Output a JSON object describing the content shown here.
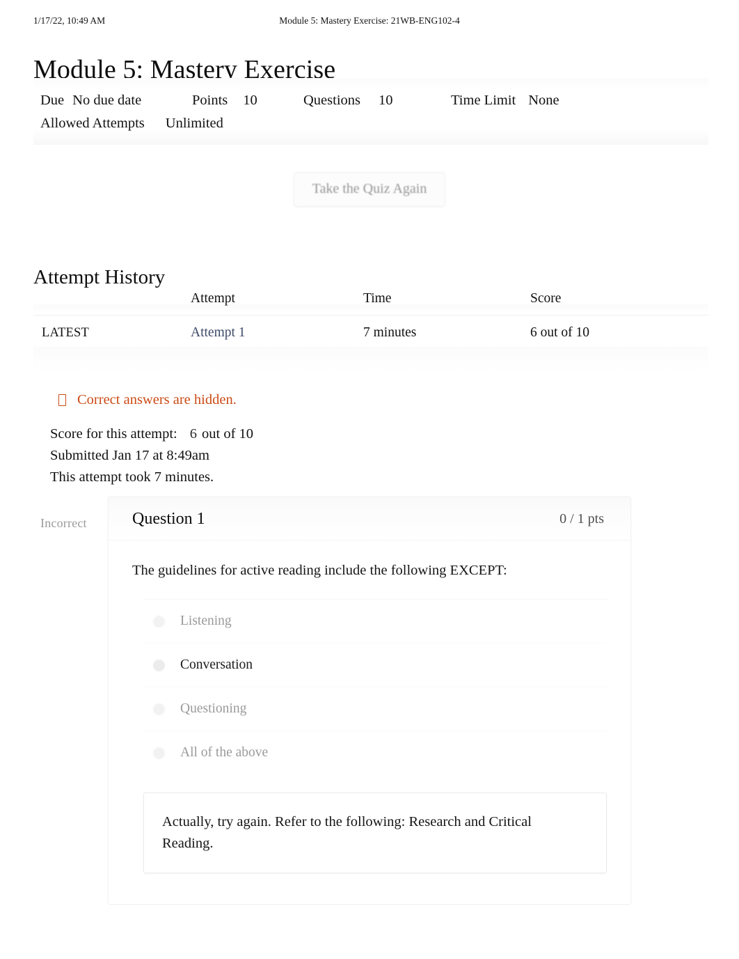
{
  "print_header": {
    "date": "1/17/22, 10:49 AM",
    "doc_title": "Module 5: Mastery Exercise: 21WB-ENG102-4"
  },
  "page_title": "Module 5: Mastery Exercise",
  "quiz_meta": {
    "due_label": "Due",
    "due_value": "No due date",
    "points_label": "Points",
    "points_value": "10",
    "questions_label": "Questions",
    "questions_value": "10",
    "time_limit_label": "Time Limit",
    "time_limit_value": "None",
    "allowed_attempts_label": "Allowed Attempts",
    "allowed_attempts_value": "Unlimited"
  },
  "retake_button": {
    "label": "Take the Quiz Again"
  },
  "attempt_history": {
    "heading": "Attempt History",
    "columns": [
      "",
      "Attempt",
      "Time",
      "Score"
    ],
    "rows": [
      {
        "kept": "LATEST",
        "attempt": "Attempt 1",
        "time": "7 minutes",
        "score": "6 out of 10"
      }
    ]
  },
  "hidden_notice": {
    "icon": "eye-slash-icon",
    "text": "Correct answers are hidden.",
    "color": "#cb4a14"
  },
  "attempt_summary": {
    "score_label": "Score for this attempt:",
    "score_value": "6",
    "score_suffix": "out of 10",
    "submitted": "Submitted Jan 17 at 8:49am",
    "duration": "This attempt took 7 minutes."
  },
  "question": {
    "status": "Incorrect",
    "name": "Question 1",
    "points": "0 / 1 pts",
    "text": "The guidelines for active reading include the following EXCEPT:",
    "answers": [
      {
        "label": "Listening",
        "selected": false
      },
      {
        "label": "Conversation",
        "selected": true
      },
      {
        "label": "Questioning",
        "selected": false
      },
      {
        "label": "All of the above",
        "selected": false
      }
    ],
    "feedback": "Actually, try again. Refer to the following: Research and Critical Reading."
  }
}
